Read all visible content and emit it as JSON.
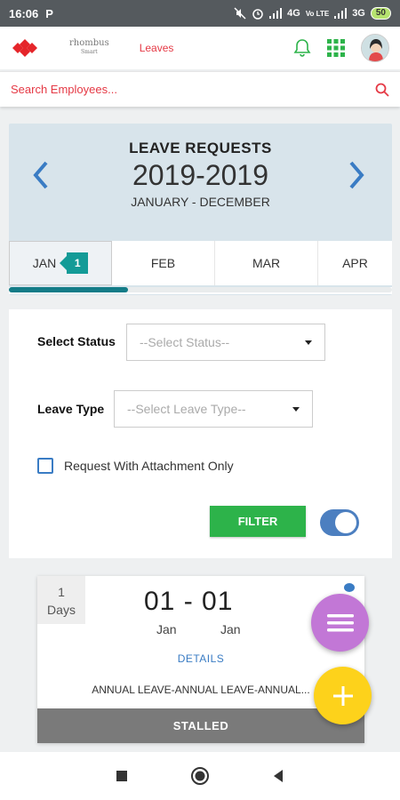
{
  "status_bar": {
    "time": "16:06",
    "app_indicator": "P",
    "network": "4G",
    "volte": "Vo LTE",
    "network2": "3G",
    "battery": "50"
  },
  "header": {
    "brand_name": "rhombus",
    "brand_sub": "Smart",
    "page_label": "Leaves",
    "icons": [
      "bell-icon",
      "grid-icon",
      "avatar"
    ]
  },
  "search": {
    "placeholder": "Search Employees..."
  },
  "leave_requests": {
    "title": "LEAVE REQUESTS",
    "year": "2019-2019",
    "range": "JANUARY - DECEMBER",
    "months": [
      {
        "label": "JAN",
        "count": "1",
        "active": true
      },
      {
        "label": "FEB"
      },
      {
        "label": "MAR"
      },
      {
        "label": "APR"
      }
    ],
    "progress": 0.31
  },
  "filters": {
    "status_label": "Select Status",
    "status_placeholder": "--Select Status--",
    "type_label": "Leave Type",
    "type_placeholder": "--Select Leave Type--",
    "attachment_label": "Request With Attachment Only",
    "filter_button": "FILTER",
    "toggle_on": true
  },
  "leave_item": {
    "days_count": "1",
    "days_unit": "Days",
    "date_range": "01 - 01",
    "from_month": "Jan",
    "to_month": "Jan",
    "details_link": "DETAILS",
    "description": "ANNUAL LEAVE-ANNUAL LEAVE-ANNUAL...",
    "status": "STALLED"
  },
  "colors": {
    "accent_red": "#e53945",
    "teal": "#137c87",
    "green": "#2db34a",
    "blue": "#3a7cc4",
    "fab_purple": "#c277d6",
    "fab_yellow": "#fdd21b",
    "status_grey": "#7a7a7a"
  }
}
